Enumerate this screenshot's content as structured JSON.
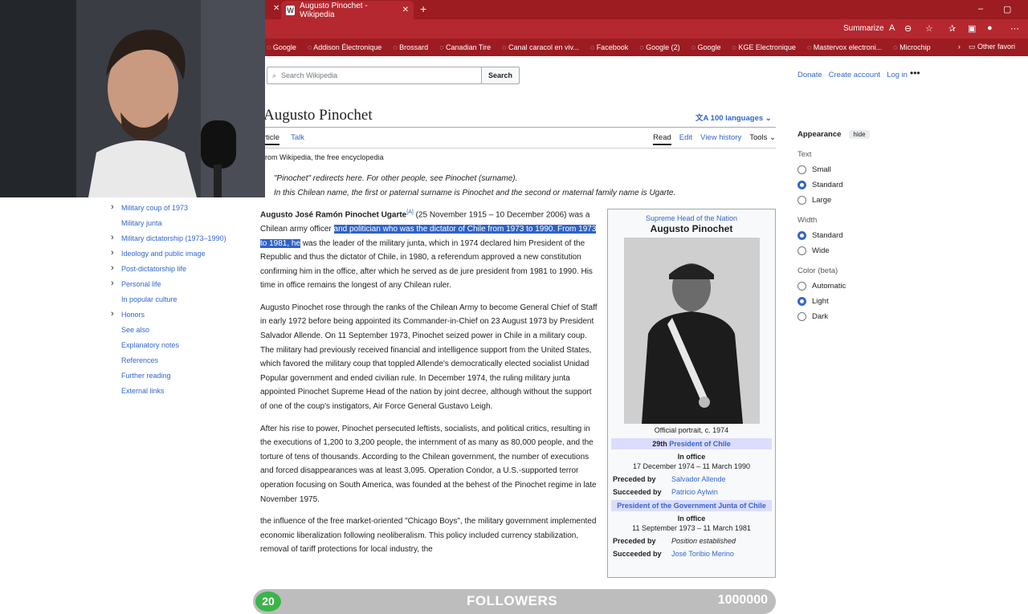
{
  "browser": {
    "tab_title": "Augusto Pinochet - Wikipedia",
    "tab_favicon": "W",
    "summarize": "Summarize",
    "bookmarks": [
      "Google",
      "Addison Électronique",
      "Brossard",
      "Canadian Tire",
      "Canal caracol en viv...",
      "Facebook",
      "Google (2)",
      "Google",
      "KGE Electronique",
      "Mastervox electroni...",
      "Microchip"
    ],
    "other_favorites": "Other favori"
  },
  "wiki": {
    "search_placeholder": "Search Wikipedia",
    "search_button": "Search",
    "top_links": [
      "Donate",
      "Create account",
      "Log in"
    ],
    "title": "Augusto Pinochet",
    "languages": "100 languages",
    "tabs_left": [
      "rticle",
      "Talk"
    ],
    "tabs_right": [
      "Read",
      "Edit",
      "View history",
      "Tools"
    ],
    "from": "rom Wikipedia, the free encyclopedia",
    "hatnote1": "\"Pinochet\" redirects here. For other people, see Pinochet (surname).",
    "hatnote2": "In this Chilean name, the first or paternal surname is Pinochet and the second or maternal family name is Ugarte."
  },
  "toc": [
    {
      "label": "Military coup of 1973",
      "expand": true
    },
    {
      "label": "Military junta",
      "expand": false
    },
    {
      "label": "Military dictatorship (1973–1990)",
      "expand": true
    },
    {
      "label": "Ideology and public image",
      "expand": true
    },
    {
      "label": "Post-dictatorship life",
      "expand": true
    },
    {
      "label": "Personal life",
      "expand": true
    },
    {
      "label": "In popular culture",
      "expand": false
    },
    {
      "label": "Honors",
      "expand": true
    },
    {
      "label": "See also",
      "expand": false
    },
    {
      "label": "Explanatory notes",
      "expand": false
    },
    {
      "label": "References",
      "expand": false
    },
    {
      "label": "Further reading",
      "expand": false
    },
    {
      "label": "External links",
      "expand": false
    }
  ],
  "lead": {
    "p1_name": "Augusto José Ramón Pinochet Ugarte",
    "p1_a": "(25 November 1915 – 10 December 2006) was a Chilean army officer ",
    "p1_hl": "and politician who was the dictator of Chile from 1973 to 1990. From 1973 to 1981, he",
    "p1_b": " was the leader of the military junta, which in 1974 declared him President of the Republic and thus the dictator of Chile, in 1980, a referendum approved a new constitution confirming him in the office, after which he served as de jure president from 1981 to 1990. His time in office remains the longest of any Chilean ruler.",
    "p2": "Augusto Pinochet rose through the ranks of the Chilean Army to become General Chief of Staff in early 1972 before being appointed its Commander-in-Chief on 23 August 1973 by President Salvador Allende. On 11 September 1973, Pinochet seized power in Chile in a military coup. The military had previously received financial and intelligence support from the United States, which favored the military coup that toppled Allende's democratically elected socialist Unidad Popular government and ended civilian rule. In December 1974, the ruling military junta appointed Pinochet Supreme Head of the nation by joint decree, although without the support of one of the coup's instigators, Air Force General Gustavo Leigh.",
    "p3": "After his rise to power, Pinochet persecuted leftists, socialists, and political critics, resulting in the executions of 1,200 to 3,200 people, the internment of as many as 80,000 people, and the torture of tens of thousands. According to the Chilean government, the number of executions and forced disappearances was at least 3,095. Operation Condor, a U.S.-supported terror operation focusing on South America, was founded at the behest of the Pinochet regime in late November 1975.",
    "p4": "the influence of the free market-oriented \"Chicago Boys\", the military government implemented economic liberalization following neoliberalism. This policy included currency stabilization, removal of tariff protections for local industry, the"
  },
  "infobox": {
    "above": "Supreme Head of the Nation",
    "name": "Augusto Pinochet",
    "caption": "Official portrait, c. 1974",
    "office1_n": "29th",
    "office1": "President of Chile",
    "in_office": "In office",
    "dates1": "17 December 1974 – 11 March 1990",
    "preceded_label": "Preceded by",
    "succeeded_label": "Succeeded by",
    "preceded1": "Salvador Allende",
    "succeeded1": "Patricio Aylwin",
    "office2": "President of the Government Junta of Chile",
    "dates2": "11 September 1973 – 11 March 1981",
    "preceded2": "Position established",
    "succeeded2": "José Toribio Merino"
  },
  "appearance": {
    "title": "Appearance",
    "hide": "hide",
    "text_label": "Text",
    "text_opts": [
      "Small",
      "Standard",
      "Large"
    ],
    "width_label": "Width",
    "width_opts": [
      "Standard",
      "Wide"
    ],
    "color_label": "Color (beta)",
    "color_opts": [
      "Automatic",
      "Light",
      "Dark"
    ]
  },
  "overlay": {
    "count": "20",
    "label": "FOLLOWERS",
    "goal": "1000000"
  },
  "colors": {
    "browser_red": "#9c1c22",
    "link": "#3366cc",
    "selection": "#2f62c8",
    "badge_green": "#3bb54a"
  }
}
